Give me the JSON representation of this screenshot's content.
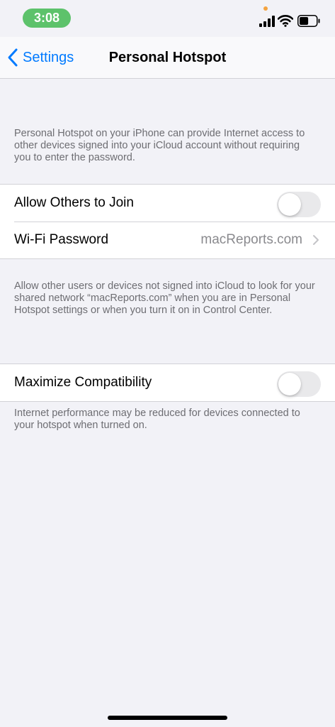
{
  "status_bar": {
    "time": "3:08",
    "time_pill_color": "#5dc26b",
    "privacy_dot_color": "#f4a340",
    "icons": [
      "cellular-signal-icon",
      "wifi-icon",
      "battery-icon"
    ],
    "battery_level": 0.55
  },
  "nav": {
    "back_label": "Settings",
    "title": "Personal Hotspot",
    "accent_color": "#007aff"
  },
  "intro_text": "Personal Hotspot on your iPhone can provide Internet access to other devices signed into your iCloud account without requiring you to enter the password.",
  "sharing_group": {
    "allow_others": {
      "label": "Allow Others to Join",
      "on": false
    },
    "wifi_password": {
      "label": "Wi-Fi Password",
      "value": "macReports.com"
    }
  },
  "sharing_footer": "Allow other users or devices not signed into iCloud to look for your shared network “macReports.com” when you are in Personal Hotspot settings or when you turn it on in Control Center.",
  "compat_group": {
    "maximize": {
      "label": "Maximize Compatibility",
      "on": false
    }
  },
  "compat_footer": "Internet performance may be reduced for devices connected to your hotspot when turned on."
}
